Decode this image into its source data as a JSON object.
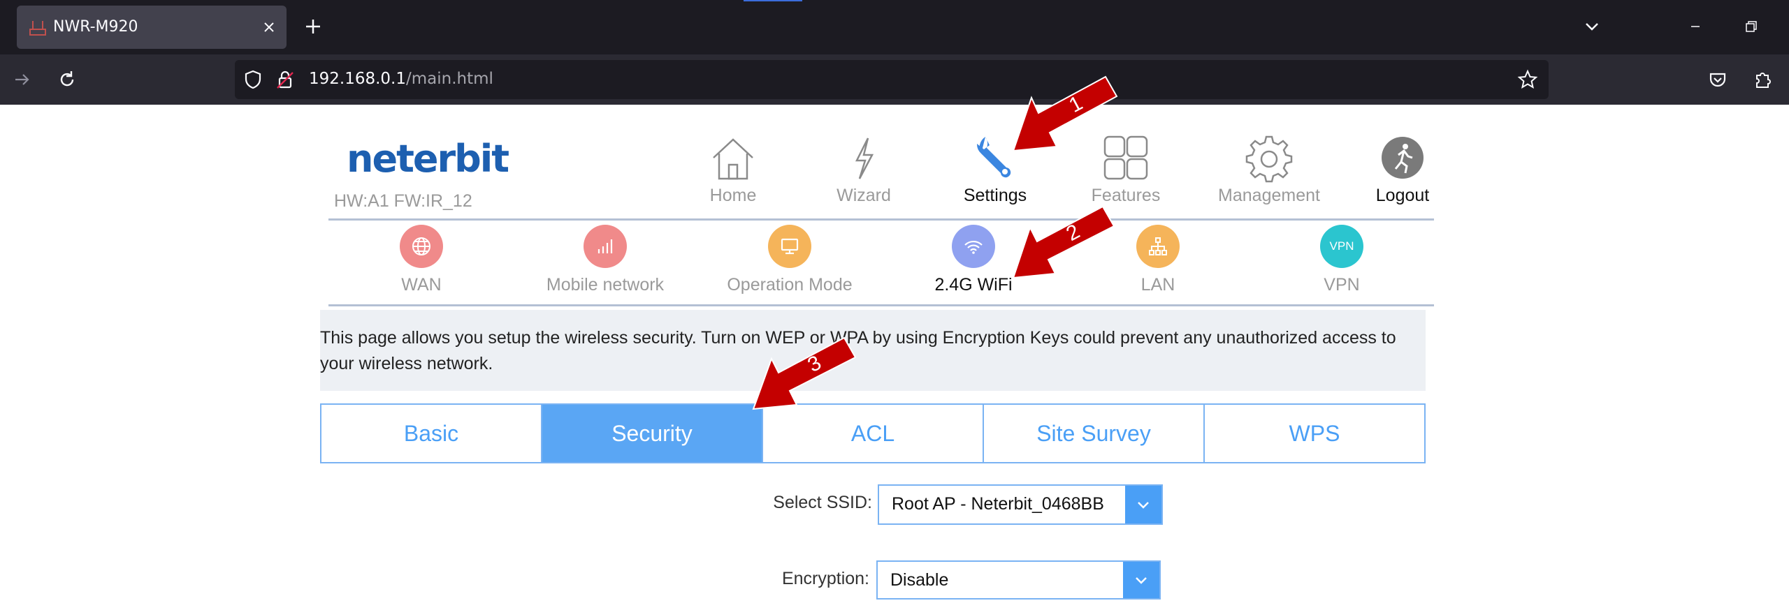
{
  "browser": {
    "tab_title": "NWR-M920",
    "url_host": "192.168.0.1",
    "url_path": "/main.html"
  },
  "header": {
    "logo_text": "neterbit",
    "firmware_info": "HW:A1 FW:IR_12"
  },
  "top_nav": [
    {
      "label": "Home",
      "icon": "home-icon"
    },
    {
      "label": "Wizard",
      "icon": "lightning-icon"
    },
    {
      "label": "Settings",
      "icon": "wrench-icon",
      "active": true
    },
    {
      "label": "Features",
      "icon": "grid-icon"
    },
    {
      "label": "Management",
      "icon": "gear-icon"
    },
    {
      "label": "Logout",
      "icon": "logout-runner-icon"
    }
  ],
  "sub_nav": [
    {
      "label": "WAN",
      "icon": "globe-icon",
      "color": "#f08a8a"
    },
    {
      "label": "Mobile network",
      "icon": "signal-bars-icon",
      "color": "#f08a8a"
    },
    {
      "label": "Operation Mode",
      "icon": "monitor-icon",
      "color": "#f5b45a"
    },
    {
      "label": "2.4G WiFi",
      "icon": "wifi-icon",
      "color": "#8fa1f0",
      "active": true
    },
    {
      "label": "LAN",
      "icon": "network-tree-icon",
      "color": "#f5b45a"
    },
    {
      "label": "VPN",
      "icon": "vpn-badge-icon",
      "icon_text": "VPN",
      "color": "#2bc5cf"
    }
  ],
  "description": "This page allows you setup the wireless security. Turn on WEP or WPA by using Encryption Keys could prevent any unauthorized access to your wireless network.",
  "wifi_tabs": [
    {
      "label": "Basic"
    },
    {
      "label": "Security",
      "active": true
    },
    {
      "label": "ACL"
    },
    {
      "label": "Site Survey"
    },
    {
      "label": "WPS"
    }
  ],
  "form": {
    "ssid_label": "Select SSID:",
    "ssid_value": "Root AP - Neterbit_0468BB",
    "encryption_label": "Encryption:",
    "encryption_value": "Disable"
  },
  "annotations": [
    {
      "number": "1",
      "color": "#c40000"
    },
    {
      "number": "2",
      "color": "#c40000"
    },
    {
      "number": "3",
      "color": "#c40000"
    }
  ],
  "colors": {
    "accent_blue": "#4a9ff6",
    "tab_active": "#5aa6f4",
    "logo_blue": "#1d5fb0",
    "annotation_red": "#c40000"
  }
}
